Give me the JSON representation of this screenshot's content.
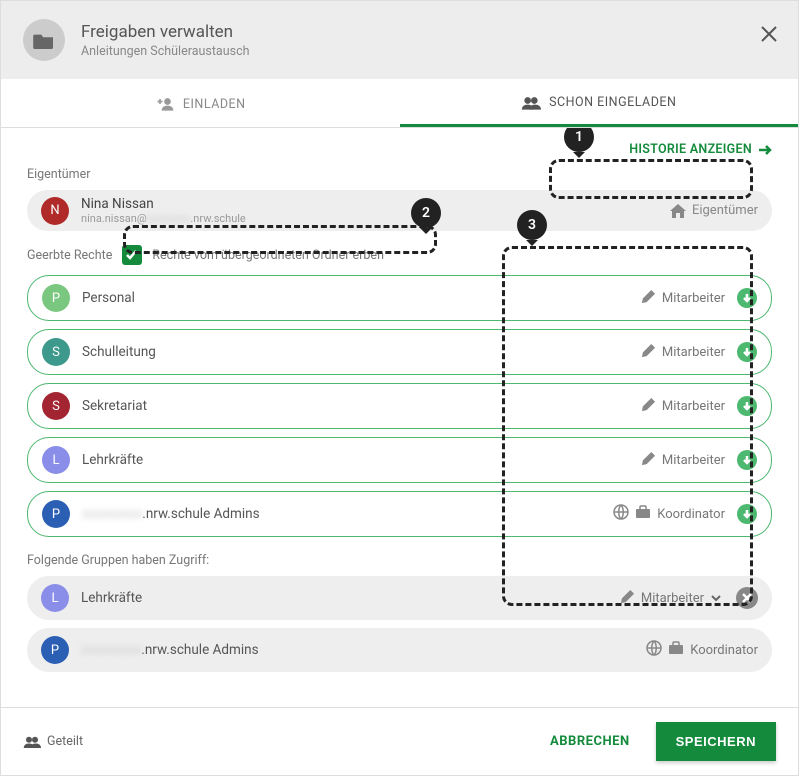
{
  "header": {
    "title": "Freigaben verwalten",
    "subtitle": "Anleitungen Schüleraustausch"
  },
  "tabs": {
    "invite": "EINLADEN",
    "invited": "SCHON EINGELADEN"
  },
  "history_link": "HISTORIE ANZEIGEN",
  "owner_label": "Eigentümer",
  "owner": {
    "name": "Nina Nissan",
    "email_prefix": "nina.nissan@",
    "email_blur": "xxxxxxxx",
    "email_suffix": ".nrw.schule",
    "role": "Eigentümer",
    "avatar_letter": "N",
    "avatar_color": "#b02a2a"
  },
  "inherit": {
    "label": "Geerbte Rechte",
    "checkbox_text": "Rechte vom übergeordneten Ordner erben",
    "checked": true
  },
  "inherited_groups": [
    {
      "letter": "P",
      "color": "#7ac77f",
      "name": "Personal",
      "role": "Mitarbeiter",
      "icons": [
        "pencil"
      ]
    },
    {
      "letter": "S",
      "color": "#3d998c",
      "name": "Schulleitung",
      "role": "Mitarbeiter",
      "icons": [
        "pencil"
      ]
    },
    {
      "letter": "S",
      "color": "#a32531",
      "name": "Sekretariat",
      "role": "Mitarbeiter",
      "icons": [
        "pencil"
      ]
    },
    {
      "letter": "L",
      "color": "#8a8ee8",
      "name": "Lehrkräfte",
      "role": "Mitarbeiter",
      "icons": [
        "pencil"
      ]
    },
    {
      "letter": "P",
      "color": "#2b5fb3",
      "name_blur": "xxxxxxxxx",
      "name_suffix": ".nrw.schule Admins",
      "role": "Koordinator",
      "icons": [
        "globe",
        "briefcase"
      ]
    }
  ],
  "access_label": "Folgende Gruppen haben Zugriff:",
  "access_groups": [
    {
      "letter": "L",
      "color": "#8a8ee8",
      "name": "Lehrkräfte",
      "role": "Mitarbeiter",
      "icons": [
        "pencil"
      ],
      "dropdown": true,
      "removable": true
    },
    {
      "letter": "P",
      "color": "#2b5fb3",
      "name_blur": "xxxxxxxxx",
      "name_suffix": ".nrw.schule Admins",
      "role": "Koordinator",
      "icons": [
        "globe",
        "briefcase"
      ]
    }
  ],
  "footer": {
    "shared": "Geteilt",
    "cancel": "ABBRECHEN",
    "save": "SPEICHERN"
  },
  "callouts": {
    "1": "1",
    "2": "2",
    "3": "3"
  }
}
